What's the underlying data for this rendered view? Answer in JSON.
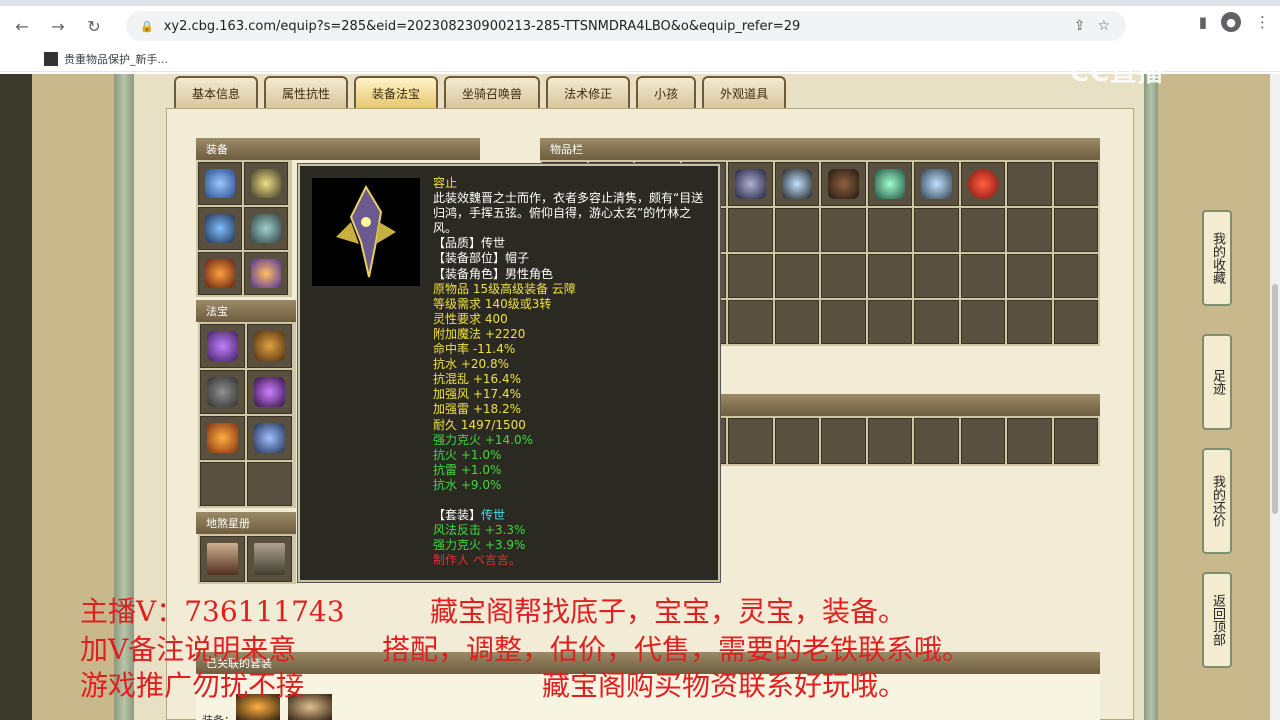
{
  "browser": {
    "url": "xy2.cbg.163.com/equip?s=285&eid=202308230900213-285-TTSNMDRA4LBO&o&equip_refer=29",
    "bookmark": "贵重物品保护_新手..."
  },
  "logo": "CC直播",
  "tabs": [
    "基本信息",
    "属性抗性",
    "装备法宝",
    "坐骑召唤兽",
    "法术修正",
    "小孩",
    "外观道具"
  ],
  "sections": {
    "equip": "装备",
    "items": "物品栏",
    "fabao": "法宝",
    "dijiang": "地煞星册",
    "bottom": "已关联的套装",
    "bottom_label": "装备："
  },
  "tooltip": {
    "name": "容止",
    "desc": "此装效魏晋之士而作，衣者多容止清隽，颇有“目送归鸿，手挥五弦。俯仰自得，游心太玄”的竹林之风。",
    "quality": "【品质】传世",
    "part": "【装备部位】帽子",
    "role": "【装备角色】男性角色",
    "origin": "原物品 15级高级装备 云障",
    "level": "等级需求 140级或3转",
    "spirit": "灵性要求 400",
    "attrs_green": [
      "附加魔法 +2220",
      "命中率 -11.4%",
      "抗水 +20.8%",
      "抗混乱 +16.4%",
      "加强风 +17.4%",
      "加强雷 +18.2%",
      "耐久 1497/1500"
    ],
    "attrs_extra": [
      "强力克火 +14.0%",
      "抗火 +1.0%",
      "抗雷 +1.0%",
      "抗水 +9.0%"
    ],
    "set_label": "【套装】",
    "set_name": "传世",
    "set_attrs": [
      "风法反击 +3.3%",
      "强力克火 +3.9%"
    ],
    "maker": "制作人 ぺ言言。"
  },
  "side_buttons": [
    "我的收藏",
    "足迹",
    "我的还价",
    "返回顶部"
  ],
  "overlay": {
    "line1a": "主播V：736111743",
    "line1b": "藏宝阁帮找底子，宝宝，灵宝，装备。",
    "line2a": "加V备注说明来意",
    "line2b": "搭配，调整，估价，代售，需要的老铁联系哦。",
    "line3a": "游戏推广勿扰不接",
    "line3b": "藏宝阁购买物资联系好玩哦。"
  },
  "colors": {
    "tooltip_bg": "#2b2a22",
    "yellow": "#f0e040",
    "green": "#40d840",
    "red": "#e02020"
  }
}
